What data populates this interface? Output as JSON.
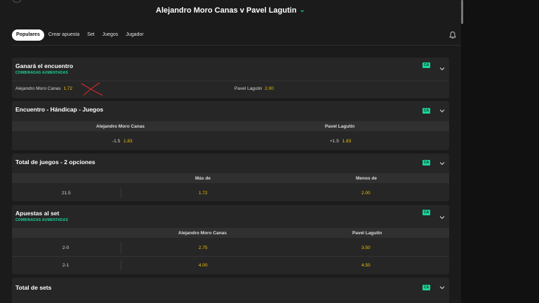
{
  "header": {
    "title": "Alejandro Moro Canas v Pavel Lagutin"
  },
  "nav": {
    "tabs": [
      {
        "label": "Populares",
        "active": true
      },
      {
        "label": "Crear apuesta",
        "active": false
      },
      {
        "label": "Set",
        "active": false
      },
      {
        "label": "Juegos",
        "active": false
      },
      {
        "label": "Jugador",
        "active": false
      }
    ]
  },
  "badge_label": "CA",
  "colors": {
    "accent": "#19d49b",
    "odds": "#f0c000",
    "background": "#1b1b1b",
    "card": "#262626",
    "column_header": "#303030"
  },
  "markets": {
    "winner": {
      "title": "Ganará el encuentro",
      "subtitle": "COMBINADAS AUMENTADAS",
      "p1_name": "Alejandro Moro Canas",
      "p1_odds": "1.72",
      "p2_name": "Pavel Lagutin",
      "p2_odds": "2.00"
    },
    "handicap": {
      "title": "Encuentro - Hándicap - Juegos",
      "col1": "Alejandro Moro Canas",
      "col2": "Pavel Lagutin",
      "p1_line": "-1.5",
      "p1_odds": "1.83",
      "p2_line": "+1.5",
      "p2_odds": "1.83"
    },
    "total_games": {
      "title": "Total de juegos - 2 opciones",
      "col1": "Más de",
      "col2": "Menos de",
      "line": "21.5",
      "over_odds": "1.72",
      "under_odds": "2.00"
    },
    "set_betting": {
      "title": "Apuestas al set",
      "subtitle": "COMBINADAS AUMENTADAS",
      "col1": "Alejandro Moro Canas",
      "col2": "Pavel Lagutin",
      "rows": [
        {
          "score": "2-0",
          "p1_odds": "2.75",
          "p2_odds": "3.50"
        },
        {
          "score": "2-1",
          "p1_odds": "4.00",
          "p2_odds": "4.50"
        }
      ]
    },
    "total_sets": {
      "title": "Total de sets"
    }
  }
}
